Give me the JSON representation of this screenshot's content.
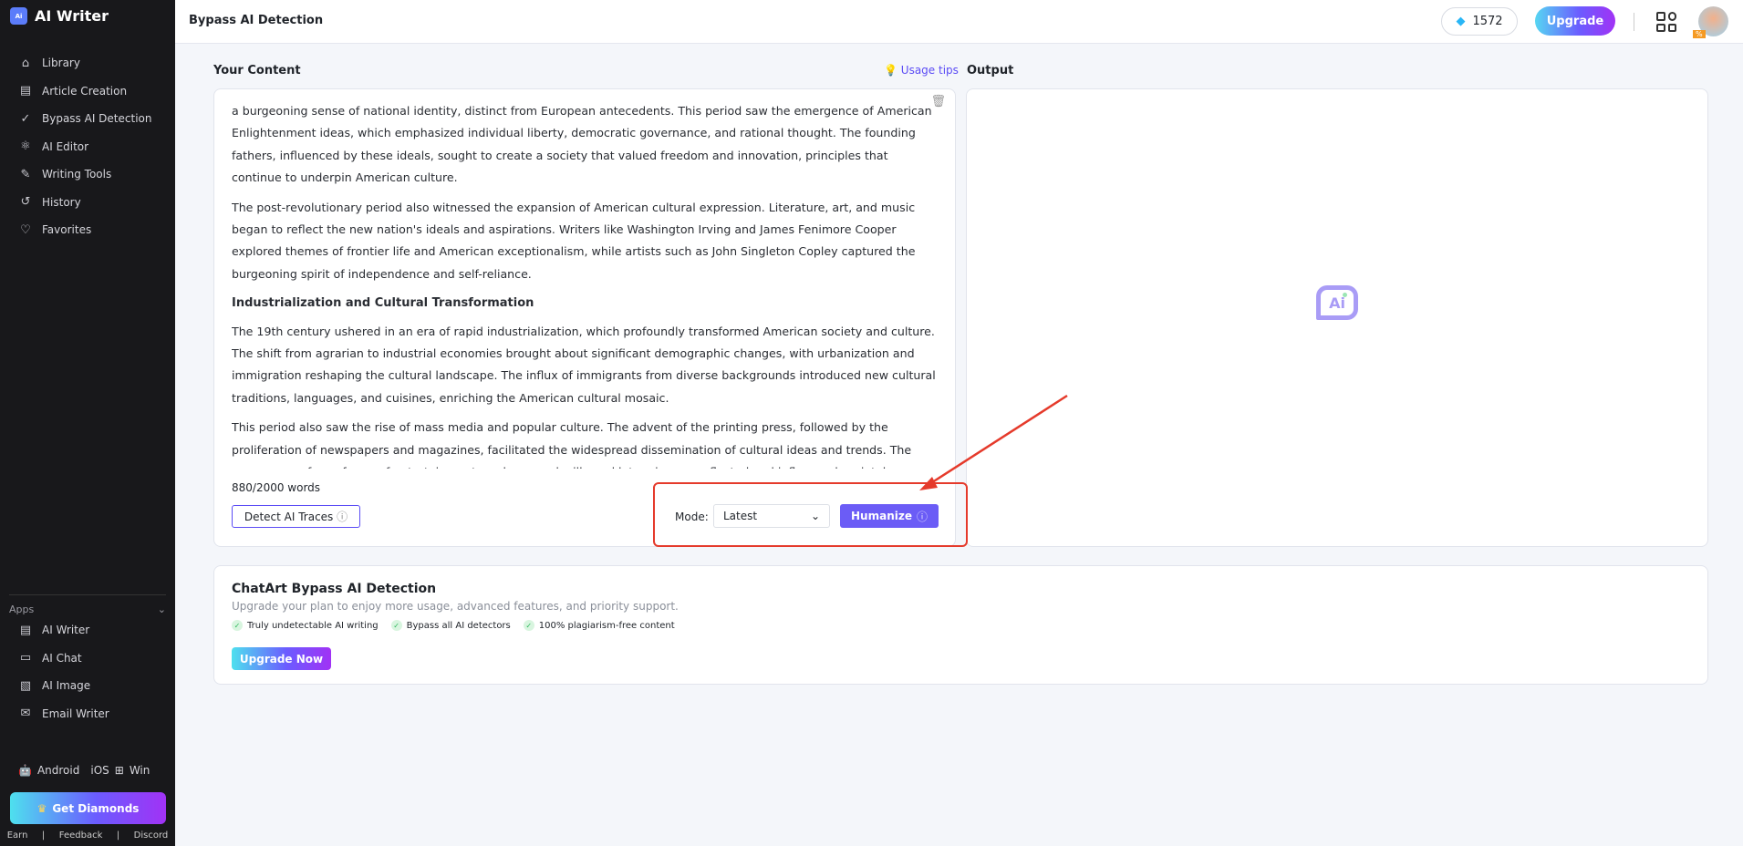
{
  "app": {
    "title": "AI Writer",
    "logo_text": "Ai"
  },
  "sidebar": {
    "items": [
      {
        "label": "Library",
        "icon": "home-icon"
      },
      {
        "label": "Article Creation",
        "icon": "document-icon"
      },
      {
        "label": "Bypass AI Detection",
        "icon": "check-circle-icon"
      },
      {
        "label": "AI Editor",
        "icon": "atom-icon"
      },
      {
        "label": "Writing Tools",
        "icon": "pencil-icon"
      },
      {
        "label": "History",
        "icon": "history-icon"
      },
      {
        "label": "Favorites",
        "icon": "heart-icon"
      }
    ],
    "apps_label": "Apps",
    "apps": [
      {
        "label": "AI Writer"
      },
      {
        "label": "AI Chat"
      },
      {
        "label": "AI Image"
      },
      {
        "label": "Email Writer"
      }
    ],
    "platforms": [
      "Android",
      "iOS",
      "Win"
    ],
    "get_diamonds": "Get Diamonds",
    "footer": [
      "Earn",
      "Feedback",
      "Discord"
    ]
  },
  "header": {
    "title": "Bypass AI Detection",
    "diamonds": "1572",
    "upgrade": "Upgrade",
    "badge": "%"
  },
  "input": {
    "label": "Your Content",
    "usage_tips": "Usage tips",
    "paragraphs": [
      {
        "type": "p",
        "text": "a burgeoning sense of national identity, distinct from European antecedents. This period saw the emergence of American Enlightenment ideas, which emphasized individual liberty, democratic governance, and rational thought. The founding fathers, influenced by these ideals, sought to create a society that valued freedom and innovation, principles that continue to underpin American culture."
      },
      {
        "type": "p",
        "text": "The post-revolutionary period also witnessed the expansion of American cultural expression. Literature, art, and music began to reflect the new nation's ideals and aspirations. Writers like Washington Irving and James Fenimore Cooper explored themes of frontier life and American exceptionalism, while artists such as John Singleton Copley captured the burgeoning spirit of independence and self-reliance."
      },
      {
        "type": "h",
        "text": "Industrialization and Cultural Transformation"
      },
      {
        "type": "p",
        "text": "The 19th century ushered in an era of rapid industrialization, which profoundly transformed American society and culture. The shift from agrarian to industrial economies brought about significant demographic changes, with urbanization and immigration reshaping the cultural landscape. The influx of immigrants from diverse backgrounds introduced new cultural traditions, languages, and cuisines, enriching the American cultural mosaic."
      },
      {
        "type": "p",
        "text": "This period also saw the rise of mass media and popular culture. The advent of the printing press, followed by the proliferation of newspapers and magazines, facilitated the widespread dissemination of cultural ideas and trends. The emergence of new forms of entertainment, such as vaudeville and later cinema, reflected and influenced societal"
      }
    ],
    "word_count": "880/2000 words",
    "detect": "Detect AI Traces",
    "mode_label": "Mode:",
    "mode_value": "Latest",
    "humanize": "Humanize"
  },
  "output": {
    "label": "Output"
  },
  "promo": {
    "title": "ChatArt Bypass AI Detection",
    "subtitle": "Upgrade your plan to enjoy more usage, advanced features, and priority support.",
    "features": [
      "Truly undetectable AI writing",
      "Bypass all AI detectors",
      "100% plagiarism-free content"
    ],
    "cta": "Upgrade Now"
  },
  "colors": {
    "accent": "#6b5cf6",
    "annotation": "#e53a2b",
    "sidebar": "#18181b"
  }
}
